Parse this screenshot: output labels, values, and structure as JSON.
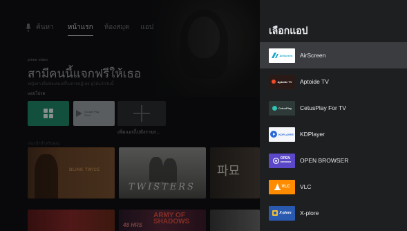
{
  "home": {
    "topbar": {
      "search_label": "ค้นหา",
      "nav_items": [
        "หน้าแรก",
        "ห้องสมุด",
        "แอป"
      ]
    },
    "hero": {
      "provider": "prime video",
      "title": "สามีคนนี้แจกฟรีให้เธอ",
      "subtitle": "หญิงสาวยื่นข้อเสนอที่ไม่อาจปฏิเสธ ดูได้แล้ววันนี้"
    },
    "apps_section_label": "แอปโปรด",
    "apps": [
      {
        "name": "apps-grid",
        "icon": "apps-grid-icon"
      },
      {
        "name": "google-play",
        "label_line1": "Google Play",
        "label_line2": "Store"
      },
      {
        "name": "add-app",
        "icon": "plus-icon"
      }
    ],
    "add_app_caption": "เพิ่มแอปไปยังรายก...",
    "section2_label": "แนะนำสำหรับคุณ",
    "movies": [
      {
        "title": "BLINK TWICE"
      },
      {
        "title": "TWISTERS"
      },
      {
        "title": "파묘"
      }
    ],
    "movies_row2": [
      {
        "title": ""
      },
      {
        "small": "48 HRS",
        "title_line1": "ARMY OF",
        "title_line2": "SHADOWS"
      },
      {
        "title": ""
      }
    ]
  },
  "panel": {
    "title": "เลือกแอป",
    "apps": [
      {
        "name": "AirScreen",
        "icon": "airscreen-icon",
        "icon_text": "AirScreen",
        "selected": true
      },
      {
        "name": "Aptoide TV",
        "icon": "aptoide-icon",
        "icon_text": "Aptoide TV",
        "selected": false
      },
      {
        "name": "CetusPlay For TV",
        "icon": "cetusplay-icon",
        "icon_text": "CetusPlay",
        "selected": false
      },
      {
        "name": "KDPlayer",
        "icon": "kdplayer-icon",
        "icon_text": "KDPLAYER",
        "selected": false
      },
      {
        "name": "OPEN BROWSER",
        "icon": "open-browser-icon",
        "icon_text_1": "OPEN",
        "icon_text_2": "BROWSER",
        "selected": false
      },
      {
        "name": "VLC",
        "icon": "vlc-icon",
        "icon_text": "VLC",
        "selected": false
      },
      {
        "name": "X-plore",
        "icon": "xplore-icon",
        "icon_text": "X-plore",
        "selected": false
      }
    ]
  },
  "colors": {
    "panel_bg": "#1e1f21",
    "selected_row": "#3a3c3f",
    "apps_tile": "#1f8a6a",
    "vlc_orange": "#ff8c00",
    "open_browser_purple": "#5a48c8"
  }
}
